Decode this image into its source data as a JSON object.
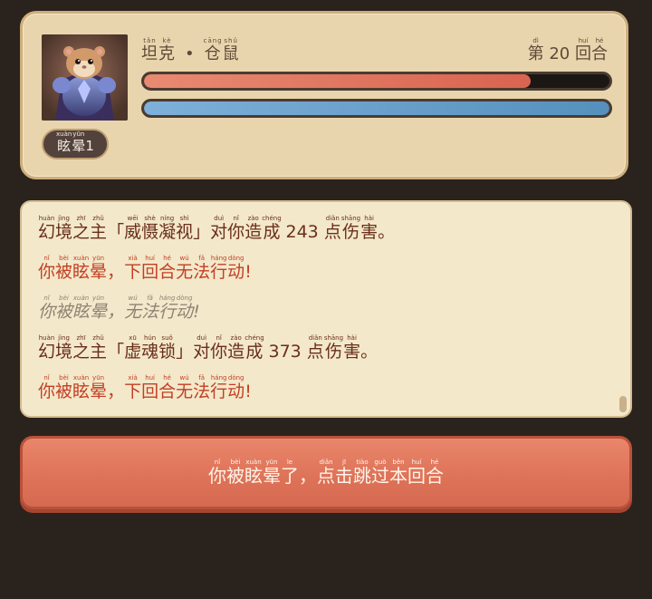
{
  "player": {
    "name_parts": [
      {
        "text": "坦",
        "ruby": "tǎn"
      },
      {
        "text": "克",
        "ruby": "kè"
      }
    ],
    "separator": "•",
    "class_parts": [
      {
        "text": "仓",
        "ruby": "cāng"
      },
      {
        "text": "鼠",
        "ruby": "shǔ"
      }
    ],
    "round_prefix": {
      "text": "第",
      "ruby": "dì"
    },
    "round_number": "20",
    "round_suffix": [
      {
        "text": "回",
        "ruby": "huí"
      },
      {
        "text": "合",
        "ruby": "hé"
      }
    ],
    "hp_fraction": 0.83,
    "mp_fraction": 1.0,
    "status_badge": [
      {
        "text": "眩",
        "ruby": "xuàn"
      },
      {
        "text": "晕",
        "ruby": "yūn"
      },
      {
        "text": "1",
        "ruby": ""
      }
    ],
    "avatar_icon": "armored-hamster-icon"
  },
  "log": [
    {
      "style": "normal",
      "parts": [
        {
          "text": "幻",
          "ruby": "huàn"
        },
        {
          "text": "境",
          "ruby": "jìng"
        },
        {
          "text": "之",
          "ruby": "zhī"
        },
        {
          "text": "主",
          "ruby": "zhǔ"
        },
        {
          "text": "「",
          "ruby": ""
        },
        {
          "text": "威",
          "ruby": "wēi"
        },
        {
          "text": "慑",
          "ruby": "shè"
        },
        {
          "text": "凝",
          "ruby": "níng"
        },
        {
          "text": "视",
          "ruby": "shì"
        },
        {
          "text": "」",
          "ruby": ""
        },
        {
          "text": "对",
          "ruby": "duì"
        },
        {
          "text": "你",
          "ruby": "nǐ"
        },
        {
          "text": "造",
          "ruby": "zào"
        },
        {
          "text": "成",
          "ruby": "chéng"
        },
        {
          "text": " 243 ",
          "ruby": ""
        },
        {
          "text": "点",
          "ruby": "diǎn"
        },
        {
          "text": "伤",
          "ruby": "shāng"
        },
        {
          "text": "害",
          "ruby": "hài"
        },
        {
          "text": "。",
          "ruby": ""
        }
      ]
    },
    {
      "style": "alert",
      "parts": [
        {
          "text": "你",
          "ruby": "nǐ"
        },
        {
          "text": "被",
          "ruby": "bèi"
        },
        {
          "text": "眩",
          "ruby": "xuàn"
        },
        {
          "text": "晕",
          "ruby": "yūn"
        },
        {
          "text": "，",
          "ruby": ""
        },
        {
          "text": "下",
          "ruby": "xià"
        },
        {
          "text": "回",
          "ruby": "huí"
        },
        {
          "text": "合",
          "ruby": "hé"
        },
        {
          "text": "无",
          "ruby": "wú"
        },
        {
          "text": "法",
          "ruby": "fǎ"
        },
        {
          "text": "行",
          "ruby": "háng"
        },
        {
          "text": "动",
          "ruby": "dòng"
        },
        {
          "text": "!",
          "ruby": ""
        }
      ]
    },
    {
      "style": "muted",
      "parts": [
        {
          "text": "你",
          "ruby": "nǐ"
        },
        {
          "text": "被",
          "ruby": "bèi"
        },
        {
          "text": "眩",
          "ruby": "xuàn"
        },
        {
          "text": "晕",
          "ruby": "yūn"
        },
        {
          "text": "，",
          "ruby": ""
        },
        {
          "text": "无",
          "ruby": "wú"
        },
        {
          "text": "法",
          "ruby": "fǎ"
        },
        {
          "text": "行",
          "ruby": "háng"
        },
        {
          "text": "动",
          "ruby": "dòng"
        },
        {
          "text": "!",
          "ruby": ""
        }
      ]
    },
    {
      "style": "normal",
      "parts": [
        {
          "text": "幻",
          "ruby": "huàn"
        },
        {
          "text": "境",
          "ruby": "jìng"
        },
        {
          "text": "之",
          "ruby": "zhī"
        },
        {
          "text": "主",
          "ruby": "zhǔ"
        },
        {
          "text": "「",
          "ruby": ""
        },
        {
          "text": "虚",
          "ruby": "xū"
        },
        {
          "text": "魂",
          "ruby": "hún"
        },
        {
          "text": "锁",
          "ruby": "suǒ"
        },
        {
          "text": "」",
          "ruby": ""
        },
        {
          "text": "对",
          "ruby": "duì"
        },
        {
          "text": "你",
          "ruby": "nǐ"
        },
        {
          "text": "造",
          "ruby": "zào"
        },
        {
          "text": "成",
          "ruby": "chéng"
        },
        {
          "text": " 373 ",
          "ruby": ""
        },
        {
          "text": "点",
          "ruby": "diǎn"
        },
        {
          "text": "伤",
          "ruby": "shāng"
        },
        {
          "text": "害",
          "ruby": "hài"
        },
        {
          "text": "。",
          "ruby": ""
        }
      ]
    },
    {
      "style": "alert",
      "parts": [
        {
          "text": "你",
          "ruby": "nǐ"
        },
        {
          "text": "被",
          "ruby": "bèi"
        },
        {
          "text": "眩",
          "ruby": "xuàn"
        },
        {
          "text": "晕",
          "ruby": "yūn"
        },
        {
          "text": "，",
          "ruby": ""
        },
        {
          "text": "下",
          "ruby": "xià"
        },
        {
          "text": "回",
          "ruby": "huí"
        },
        {
          "text": "合",
          "ruby": "hé"
        },
        {
          "text": "无",
          "ruby": "wú"
        },
        {
          "text": "法",
          "ruby": "fǎ"
        },
        {
          "text": "行",
          "ruby": "háng"
        },
        {
          "text": "动",
          "ruby": "dòng"
        },
        {
          "text": "!",
          "ruby": ""
        }
      ]
    }
  ],
  "skip_button": [
    {
      "text": "你",
      "ruby": "nǐ"
    },
    {
      "text": "被",
      "ruby": "bèi"
    },
    {
      "text": "眩",
      "ruby": "xuàn"
    },
    {
      "text": "晕",
      "ruby": "yūn"
    },
    {
      "text": "了",
      "ruby": "le"
    },
    {
      "text": "，",
      "ruby": ""
    },
    {
      "text": "点",
      "ruby": "diǎn"
    },
    {
      "text": "击",
      "ruby": "jī"
    },
    {
      "text": "跳",
      "ruby": "tiào"
    },
    {
      "text": "过",
      "ruby": "guò"
    },
    {
      "text": "本",
      "ruby": "běn"
    },
    {
      "text": "回",
      "ruby": "huí"
    },
    {
      "text": "合",
      "ruby": "hé"
    }
  ],
  "colors": {
    "hp": "#d9644f",
    "mp": "#5590bd",
    "alert_text": "#c33f25",
    "normal_text": "#6a2e1b",
    "muted_text": "#8d8374",
    "button": "#dd7257"
  }
}
